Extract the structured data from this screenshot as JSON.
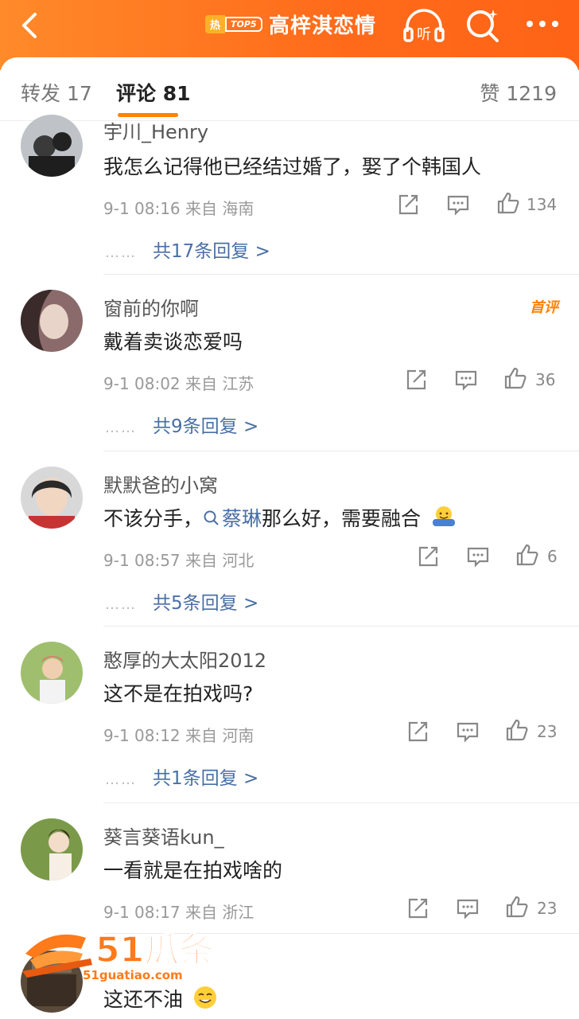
{
  "header": {
    "hot_label": "热",
    "top_label": "TOP5",
    "topic_title": "高梓淇恋情",
    "listen_label": "听"
  },
  "tabs": {
    "repost": "转发 17",
    "comment": "评论 81",
    "like": "赞 1219"
  },
  "comments": [
    {
      "user": "宇川_Henry",
      "text": "我怎么记得他已经结过婚了，娶了个韩国人",
      "meta": "9-1 08:16  来自 海南",
      "likes": "134",
      "replies": "共17条回复 >"
    },
    {
      "user": "窗前的你啊",
      "text": "戴着卖谈恋爱吗",
      "meta": "9-1 08:02  来自 江苏",
      "likes": "36",
      "replies": "共9条回复 >",
      "tag": "首评"
    },
    {
      "user": "默默爸的小窝",
      "text_prefix": "不该分手，",
      "topic": "蔡琳",
      "text_suffix": "那么好，需要融合",
      "meta": "9-1 08:57  来自 河北",
      "likes": "6",
      "replies": "共5条回复 >"
    },
    {
      "user": "憨厚的大太阳2012",
      "text": "这不是在拍戏吗?",
      "meta": "9-1 08:12  来自 河南",
      "likes": "23",
      "replies": "共1条回复 >"
    },
    {
      "user": "葵言葵语kun_",
      "text": "一看就是在拍戏啥的",
      "meta": "9-1 08:17  来自 浙江",
      "likes": "23"
    },
    {
      "text": "这还不油"
    }
  ],
  "reply_dots": "……",
  "watermark": {
    "brand": "51瓜条",
    "url": "51guatiao.com"
  },
  "colors": {
    "accent": "#ff8200",
    "link": "#4a6fa5",
    "topbar": "#ff6a1a"
  }
}
